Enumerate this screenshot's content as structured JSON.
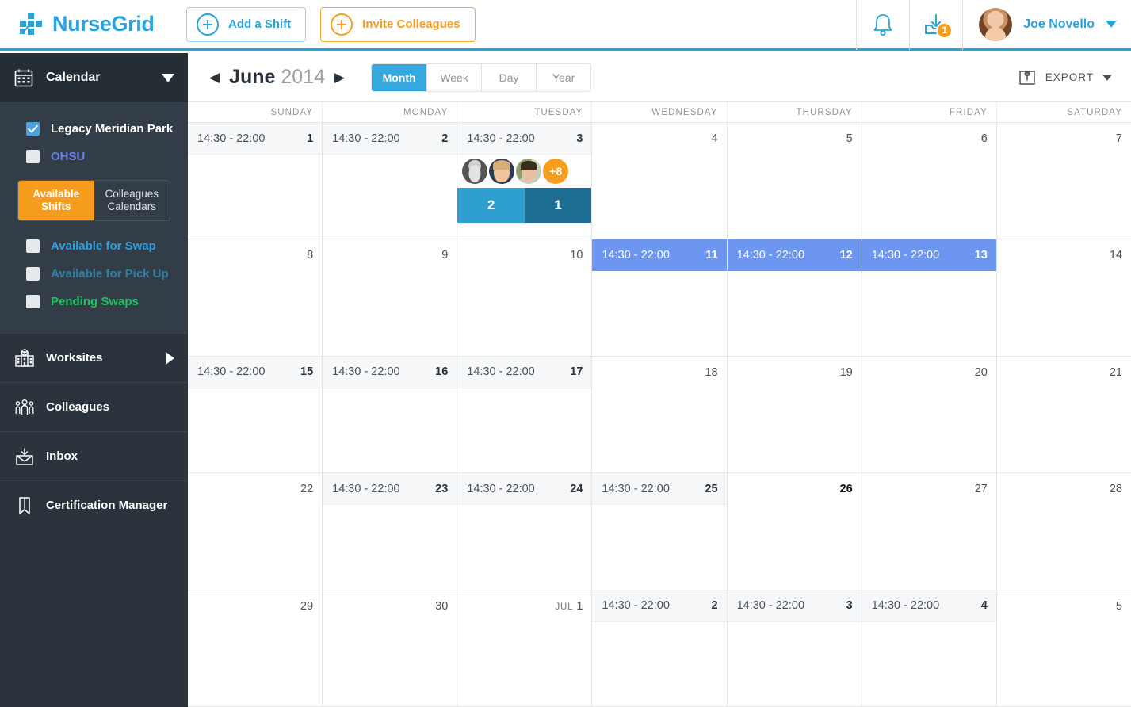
{
  "header": {
    "brand_name": "NurseGrid",
    "brand_icon": "nursegrid-cross-logo",
    "add_shift_label": "Add a Shift",
    "invite_label": "Invite Colleagues",
    "notifications_icon": "bell-icon",
    "inbox_icon": "inbox-download-icon",
    "inbox_badge": "1",
    "user_name": "Joe Novello",
    "user_avatar_icon": "user-avatar",
    "user_caret_icon": "chevron-down-icon",
    "accent_blue": "#29a3dc",
    "accent_orange": "#f79d1e"
  },
  "sidebar": {
    "calendar": {
      "icon": "calendar-icon",
      "label": "Calendar",
      "toggle_icon": "triangle-down-icon"
    },
    "worksite_filters": [
      {
        "label": "Legacy Meridian Park",
        "checked": true,
        "color": "#ffffff"
      },
      {
        "label": "OHSU",
        "checked": false,
        "color": "#6b7fe8"
      }
    ],
    "segmented": {
      "available_shifts": "Available\nShifts",
      "available_shifts_line1": "Available",
      "available_shifts_line2": "Shifts",
      "colleagues_calendars_line1": "Colleagues",
      "colleagues_calendars_line2": "Calendars",
      "active": "Available Shifts"
    },
    "shift_filters": [
      {
        "label": "Available for Swap",
        "checked": false,
        "color": "#2e9fdc"
      },
      {
        "label": "Available for Pick Up",
        "checked": false,
        "color": "#2f7fa5"
      },
      {
        "label": "Pending Swaps",
        "checked": false,
        "color": "#20c560"
      }
    ],
    "nav_items": [
      {
        "label": "Worksites",
        "icon": "hospital-icon",
        "expand_icon": "triangle-right-icon"
      },
      {
        "label": "Colleagues",
        "icon": "people-icon"
      },
      {
        "label": "Inbox",
        "icon": "inbox-envelope-icon"
      },
      {
        "label": "Certification Manager",
        "icon": "bookmark-icon"
      }
    ]
  },
  "toolbar": {
    "prev_icon": "triangle-left-icon",
    "next_icon": "triangle-right-icon",
    "month": "June",
    "year": "2014",
    "views": [
      {
        "label": "Month",
        "active": true
      },
      {
        "label": "Week",
        "active": false
      },
      {
        "label": "Day",
        "active": false
      },
      {
        "label": "Year",
        "active": false
      }
    ],
    "export_icon": "export-upload-icon",
    "export_label": "EXPORT",
    "export_caret_icon": "triangle-down-icon"
  },
  "calendar": {
    "day_names": [
      "SUNDAY",
      "MONDAY",
      "TUESDAY",
      "WEDNESDAY",
      "THURSDAY",
      "FRIDAY",
      "SATURDAY"
    ],
    "shift_time": "14:30 - 22:00",
    "selection_color": "#6d96f0",
    "weeks": [
      [
        {
          "num": "1",
          "time": "14:30 - 22:00",
          "shaded": true
        },
        {
          "num": "2",
          "time": "14:30 - 22:00",
          "shaded": true
        },
        {
          "num": "3",
          "time": "14:30 - 22:00",
          "shaded": true,
          "avatars": [
            "colleague-1",
            "colleague-2",
            "colleague-3"
          ],
          "avatar_more": "+8",
          "count_bars": [
            {
              "value": "2",
              "tone": "light"
            },
            {
              "value": "1",
              "tone": "dark"
            }
          ]
        },
        {
          "num": "4"
        },
        {
          "num": "5"
        },
        {
          "num": "6"
        },
        {
          "num": "7"
        }
      ],
      [
        {
          "num": "8"
        },
        {
          "num": "9"
        },
        {
          "num": "10"
        },
        {
          "num": "11",
          "time": "14:30 - 22:00",
          "selected": true
        },
        {
          "num": "12",
          "time": "14:30 - 22:00",
          "selected": true
        },
        {
          "num": "13",
          "time": "14:30 - 22:00",
          "selected": true
        },
        {
          "num": "14"
        }
      ],
      [
        {
          "num": "15",
          "time": "14:30 - 22:00",
          "shaded": true
        },
        {
          "num": "16",
          "time": "14:30 - 22:00",
          "shaded": true
        },
        {
          "num": "17",
          "time": "14:30 - 22:00",
          "shaded": true
        },
        {
          "num": "18"
        },
        {
          "num": "19"
        },
        {
          "num": "20"
        },
        {
          "num": "21"
        }
      ],
      [
        {
          "num": "22"
        },
        {
          "num": "23",
          "time": "14:30 - 22:00",
          "shaded": true
        },
        {
          "num": "24",
          "time": "14:30 - 22:00",
          "shaded": true
        },
        {
          "num": "25",
          "time": "14:30 - 22:00",
          "shaded": true
        },
        {
          "num": "26",
          "today": true
        },
        {
          "num": "27"
        },
        {
          "num": "28"
        }
      ],
      [
        {
          "num": "29"
        },
        {
          "num": "30"
        },
        {
          "num": "1",
          "prefix": "JUL"
        },
        {
          "num": "2",
          "time": "14:30 - 22:00",
          "shaded": true
        },
        {
          "num": "3",
          "time": "14:30 - 22:00",
          "shaded": true
        },
        {
          "num": "4",
          "time": "14:30 - 22:00",
          "shaded": true
        },
        {
          "num": "5"
        }
      ]
    ]
  }
}
